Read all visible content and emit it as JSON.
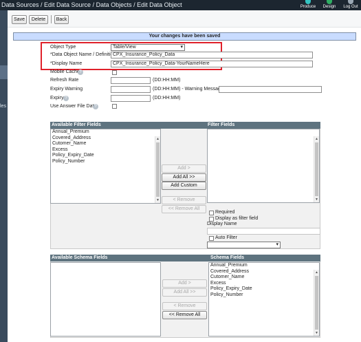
{
  "header": {
    "breadcrumb": "Data Sources / Edit Data Source / Data Objects / Edit Data Object",
    "nav": [
      {
        "label": "Produce",
        "icon": "produce-icon",
        "color": "#35c4c1"
      },
      {
        "label": "Design",
        "icon": "design-icon",
        "color": "#2fae63"
      },
      {
        "label": "Log Out",
        "icon": "logout-icon",
        "color": "#9aa7b3"
      }
    ]
  },
  "sidebar": {
    "partial_label": "les"
  },
  "toolbar": {
    "save": "Save",
    "delete": "Delete",
    "back": "Back"
  },
  "banner": {
    "message": "Your changes have been saved"
  },
  "form": {
    "object_type": {
      "label": "Object Type",
      "value": "Table/View"
    },
    "data_object_name": {
      "label": "*Data Object Name / Definition",
      "value": "CPX_Insurance_Policy_Data"
    },
    "display_name": {
      "label": "*Display Name",
      "value": "CPX_Insurance_Policy_Data-YourNameHere"
    },
    "mobile_cache": {
      "label": "Mobile Cache",
      "checked": false
    },
    "refresh_rate": {
      "label": "Refresh Rate",
      "value": "",
      "hint": "(DD:HH:MM)"
    },
    "expiry_warning": {
      "label": "Expiry Warning",
      "value": "",
      "hint": "(DD:HH:MM) - Warning Message",
      "message_value": ""
    },
    "expiry": {
      "label": "Expiry",
      "value": "",
      "hint": "(DD:HH:MM)"
    },
    "use_answer_file": {
      "label": "Use Answer File Data",
      "checked": false
    }
  },
  "filter_section": {
    "available_title": "Available Filter Fields",
    "selected_title": "Filter Fields",
    "available_items": [
      "Annual_Premium",
      "Covered_Address",
      "Cutomer_Name",
      "Excess",
      "Policy_Expiry_Date",
      "Policy_Number"
    ],
    "buttons": {
      "add": "Add >",
      "add_all": "Add All >>",
      "add_custom": "Add Custom",
      "remove": "< Remove",
      "remove_all": "<< Remove All"
    },
    "required_label": "Required",
    "display_as_filter_label": "Display as filter field",
    "display_name_label": "Display Name",
    "auto_filter_label": "Auto Filter"
  },
  "schema_section": {
    "available_title": "Available Schema Fields",
    "selected_title": "Schema Fields",
    "selected_items": [
      "Annual_Premium",
      "Covered_Address",
      "Cutomer_Name",
      "Excess",
      "Policy_Expiry_Date",
      "Policy_Number"
    ],
    "buttons": {
      "add": "Add >",
      "add_all": "Add All >>",
      "remove": "< Remove",
      "remove_all": "<< Remove All"
    }
  }
}
